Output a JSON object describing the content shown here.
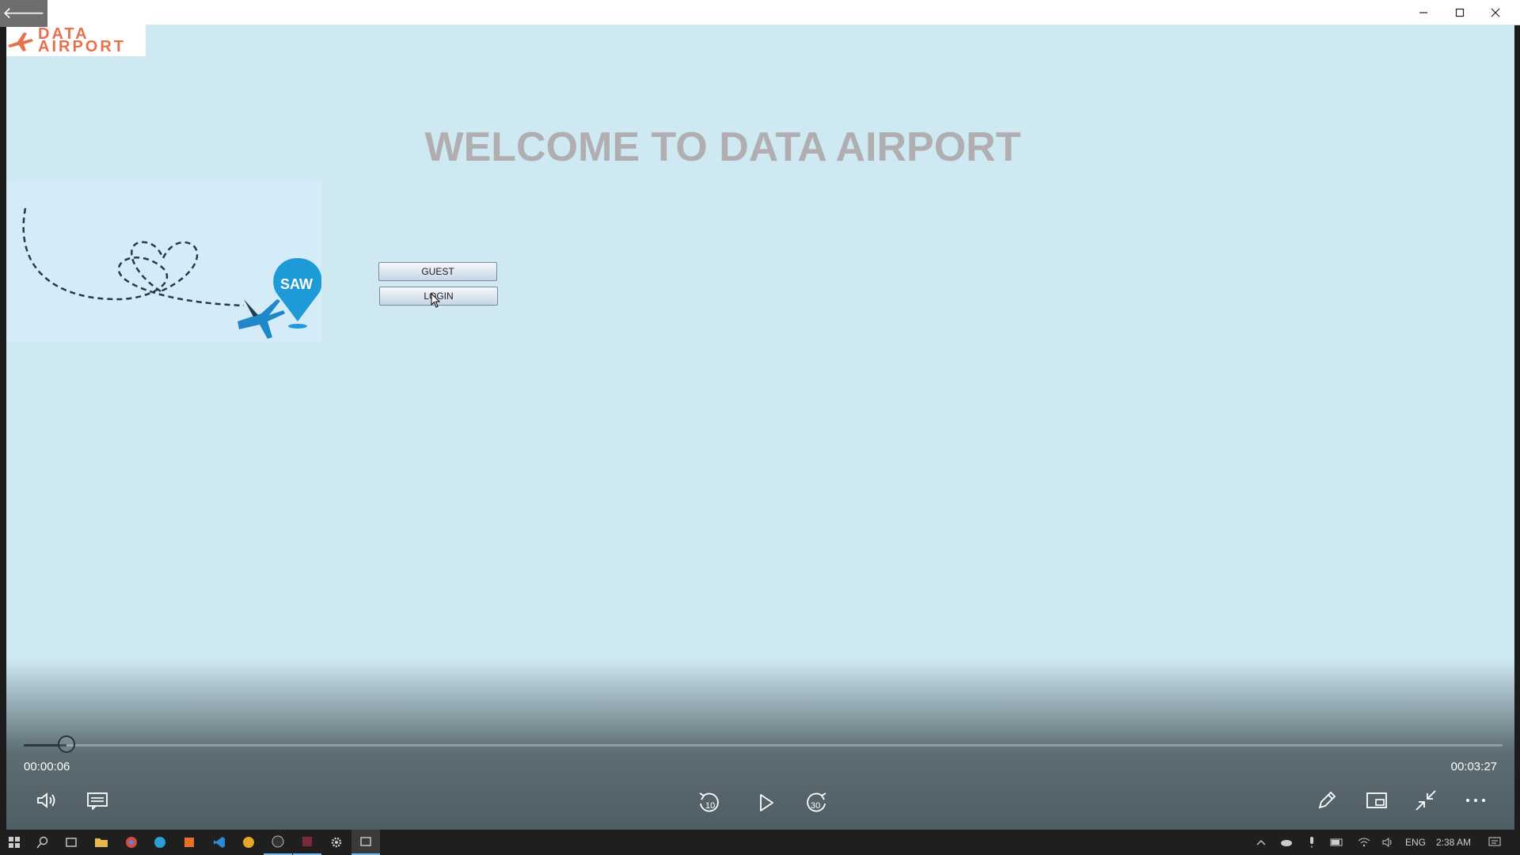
{
  "app": {
    "back_glyph": "🡐",
    "logo_text": "DATA\nAIRPORT",
    "welcome": "WELCOME TO DATA AIRPORT",
    "pin_label": "SAW",
    "buttons": {
      "guest": "GUEST",
      "login": "LOGIN"
    }
  },
  "player": {
    "elapsed": "00:00:06",
    "duration": "00:03:27",
    "progress": 0.029
  },
  "taskbar": {
    "language": "ENG",
    "clock": "2:38 AM"
  },
  "colors": {
    "video_bg": "#cfe9f3",
    "logo_orange": "#e8704c",
    "welcome_text": "#b0aeb1",
    "plane_blue": "#1e88c8"
  }
}
